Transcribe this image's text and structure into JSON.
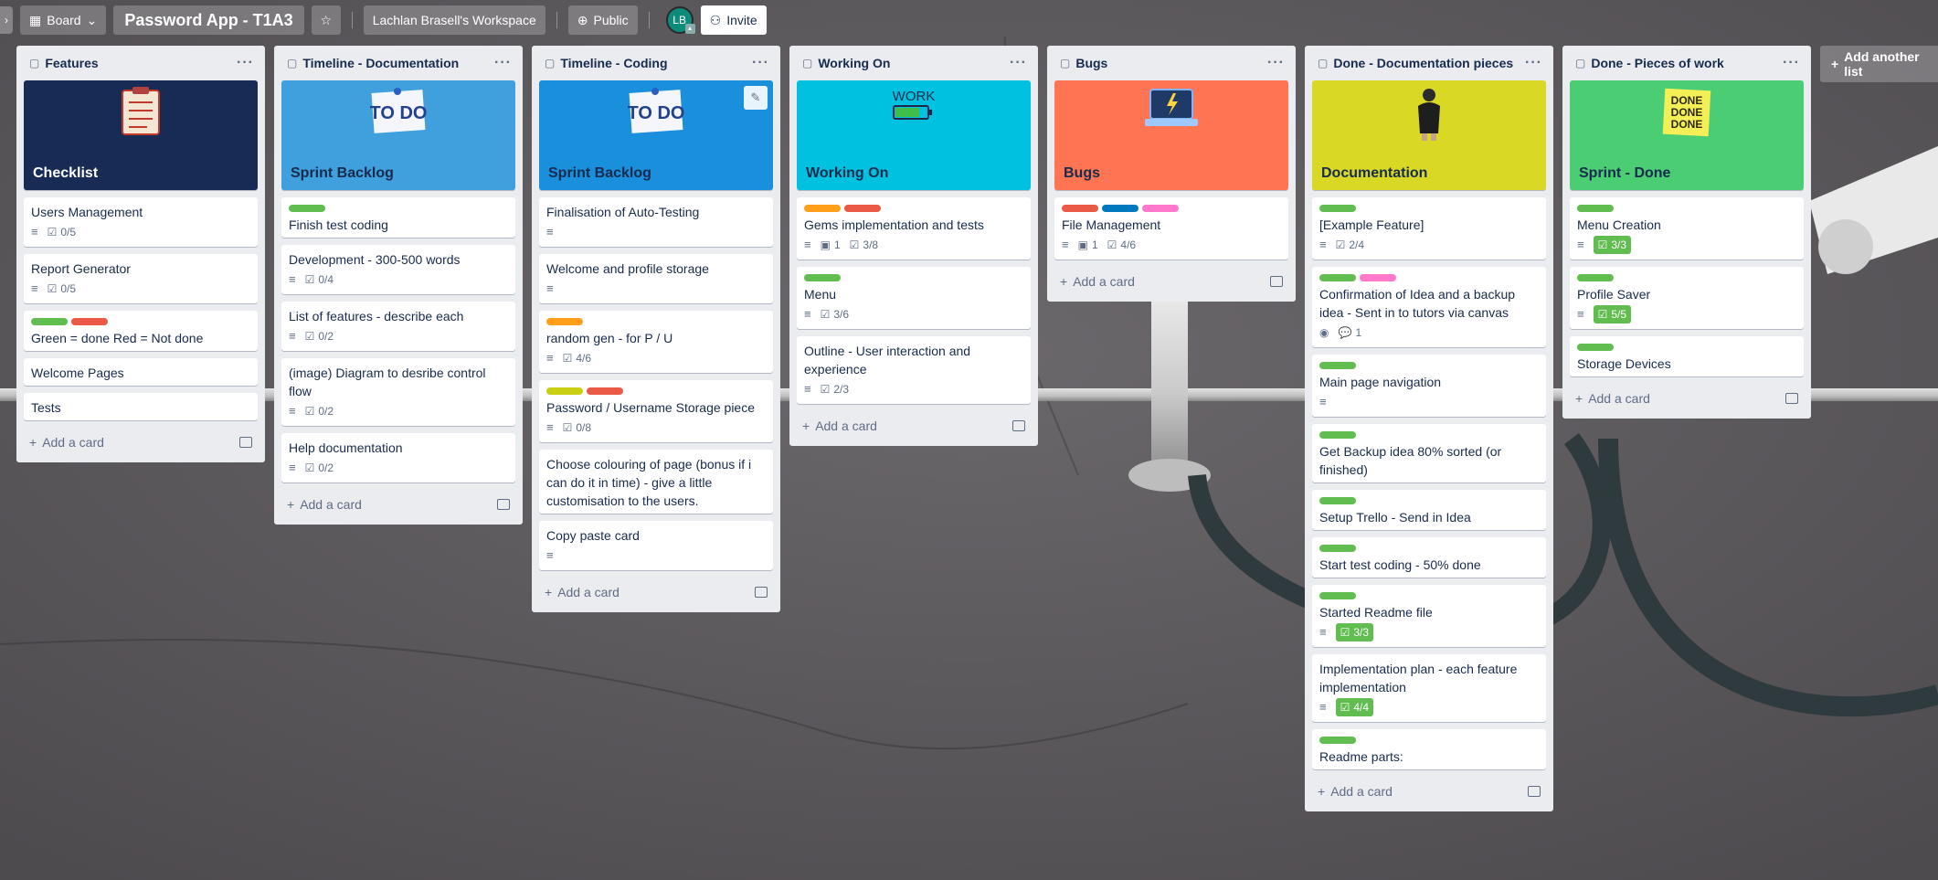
{
  "colors": {
    "green": "#61bd4f",
    "red": "#eb5a46",
    "orange": "#ff9f1a",
    "yellow": "#c9cf12",
    "blue": "#0079bf",
    "pink": "#ff78cb"
  },
  "header": {
    "view_label": "Board",
    "board_title": "Password App - T1A3",
    "workspace_label": "Lachlan Brasell's Workspace",
    "visibility_label": "Public",
    "avatar_initials": "LB",
    "invite_label": "Invite"
  },
  "add_card_label": "Add a card",
  "add_list_label": "Add another list",
  "lists": [
    {
      "title": "Features",
      "cover": {
        "title": "Checklist",
        "bg": "#172b55",
        "text": "light",
        "sticker": "checklist"
      },
      "cards": [
        {
          "title": "Users Management",
          "checklist": "0/5",
          "desc": true
        },
        {
          "title": "Report Generator",
          "checklist": "0/5",
          "desc": true
        },
        {
          "title": "Green = done Red = Not done",
          "labels": [
            "green",
            "red"
          ]
        },
        {
          "title": "Welcome Pages"
        },
        {
          "title": "Tests"
        }
      ]
    },
    {
      "title": "Timeline - Documentation",
      "cover": {
        "title": "Sprint Backlog",
        "bg": "#3fa0dd",
        "text": "dark",
        "sticker": "todo"
      },
      "cards": [
        {
          "title": "Finish test coding",
          "labels": [
            "green"
          ]
        },
        {
          "title": "Development - 300-500 words",
          "checklist": "0/4",
          "desc": true
        },
        {
          "title": "List of features - describe each",
          "checklist": "0/2",
          "desc": true
        },
        {
          "title": "(image) Diagram to desribe control flow",
          "checklist": "0/2",
          "desc": true
        },
        {
          "title": "Help documentation",
          "checklist": "0/2",
          "desc": true
        }
      ]
    },
    {
      "title": "Timeline - Coding",
      "cover": {
        "title": "Sprint Backlog",
        "bg": "#1a8fdc",
        "text": "dark",
        "sticker": "todo"
      },
      "cards": [
        {
          "title": "Finalisation of Auto-Testing",
          "desc": true
        },
        {
          "title": "Welcome and profile storage",
          "desc": true
        },
        {
          "title": "random gen - for P / U",
          "labels": [
            "orange"
          ],
          "checklist": "4/6",
          "desc": true
        },
        {
          "title": "Password / Username Storage piece",
          "labels": [
            "yellow",
            "red"
          ],
          "checklist": "0/8",
          "desc": true
        },
        {
          "title": "Choose colouring of page (bonus if i can do it in time) - give a little customisation to the users."
        },
        {
          "title": "Copy paste card",
          "desc": true
        }
      ]
    },
    {
      "title": "Working On",
      "cover": {
        "title": "Working On",
        "bg": "#00c2e0",
        "text": "dark",
        "sticker": "work"
      },
      "cards": [
        {
          "title": "Gems implementation and tests",
          "labels": [
            "orange",
            "red"
          ],
          "attachments": "1",
          "checklist": "3/8",
          "desc": true
        },
        {
          "title": "Menu",
          "labels": [
            "green"
          ],
          "checklist": "3/6",
          "desc": true
        },
        {
          "title": "Outline - User interaction and experience",
          "checklist": "2/3",
          "desc": true
        }
      ]
    },
    {
      "title": "Bugs",
      "cover": {
        "title": "Bugs",
        "bg": "#ff7452",
        "text": "dark",
        "sticker": "laptop"
      },
      "cards": [
        {
          "title": "File Management",
          "labels": [
            "red",
            "blue",
            "pink"
          ],
          "attachments": "1",
          "checklist": "4/6",
          "desc": true
        }
      ]
    },
    {
      "title": "Done - Documentation pieces",
      "cover": {
        "title": "Documentation",
        "bg": "#d9d925",
        "text": "dark",
        "sticker": "person"
      },
      "cards": [
        {
          "title": "[Example Feature]",
          "labels": [
            "green"
          ],
          "checklist": "2/4",
          "desc": true
        },
        {
          "title": "Confirmation of Idea and a backup idea - Sent in to tutors via canvas",
          "labels": [
            "green",
            "pink"
          ],
          "watch": true,
          "comments": "1"
        },
        {
          "title": "Main page navigation",
          "labels": [
            "green"
          ],
          "desc": true
        },
        {
          "title": "Get Backup idea 80% sorted (or finished)",
          "labels": [
            "green"
          ]
        },
        {
          "title": "Setup Trello - Send in Idea",
          "labels": [
            "green"
          ]
        },
        {
          "title": "Start test coding - 50% done",
          "labels": [
            "green"
          ]
        },
        {
          "title": "Started Readme file",
          "labels": [
            "green"
          ],
          "checklist": "3/3",
          "done": true,
          "desc": true
        },
        {
          "title": "Implementation plan - each feature implementation",
          "checklist": "4/4",
          "done": true,
          "desc": true
        },
        {
          "title": "Readme parts:",
          "labels": [
            "green"
          ]
        }
      ]
    },
    {
      "title": "Done - Pieces of work",
      "cover": {
        "title": "Sprint - Done",
        "bg": "#4bce73",
        "text": "dark",
        "sticker": "done"
      },
      "cards": [
        {
          "title": "Menu Creation",
          "labels": [
            "green"
          ],
          "checklist": "3/3",
          "done": true,
          "desc": true
        },
        {
          "title": "Profile Saver",
          "labels": [
            "green"
          ],
          "checklist": "5/5",
          "done": true,
          "desc": true
        },
        {
          "title": "Storage Devices",
          "labels": [
            "green"
          ]
        }
      ]
    }
  ]
}
